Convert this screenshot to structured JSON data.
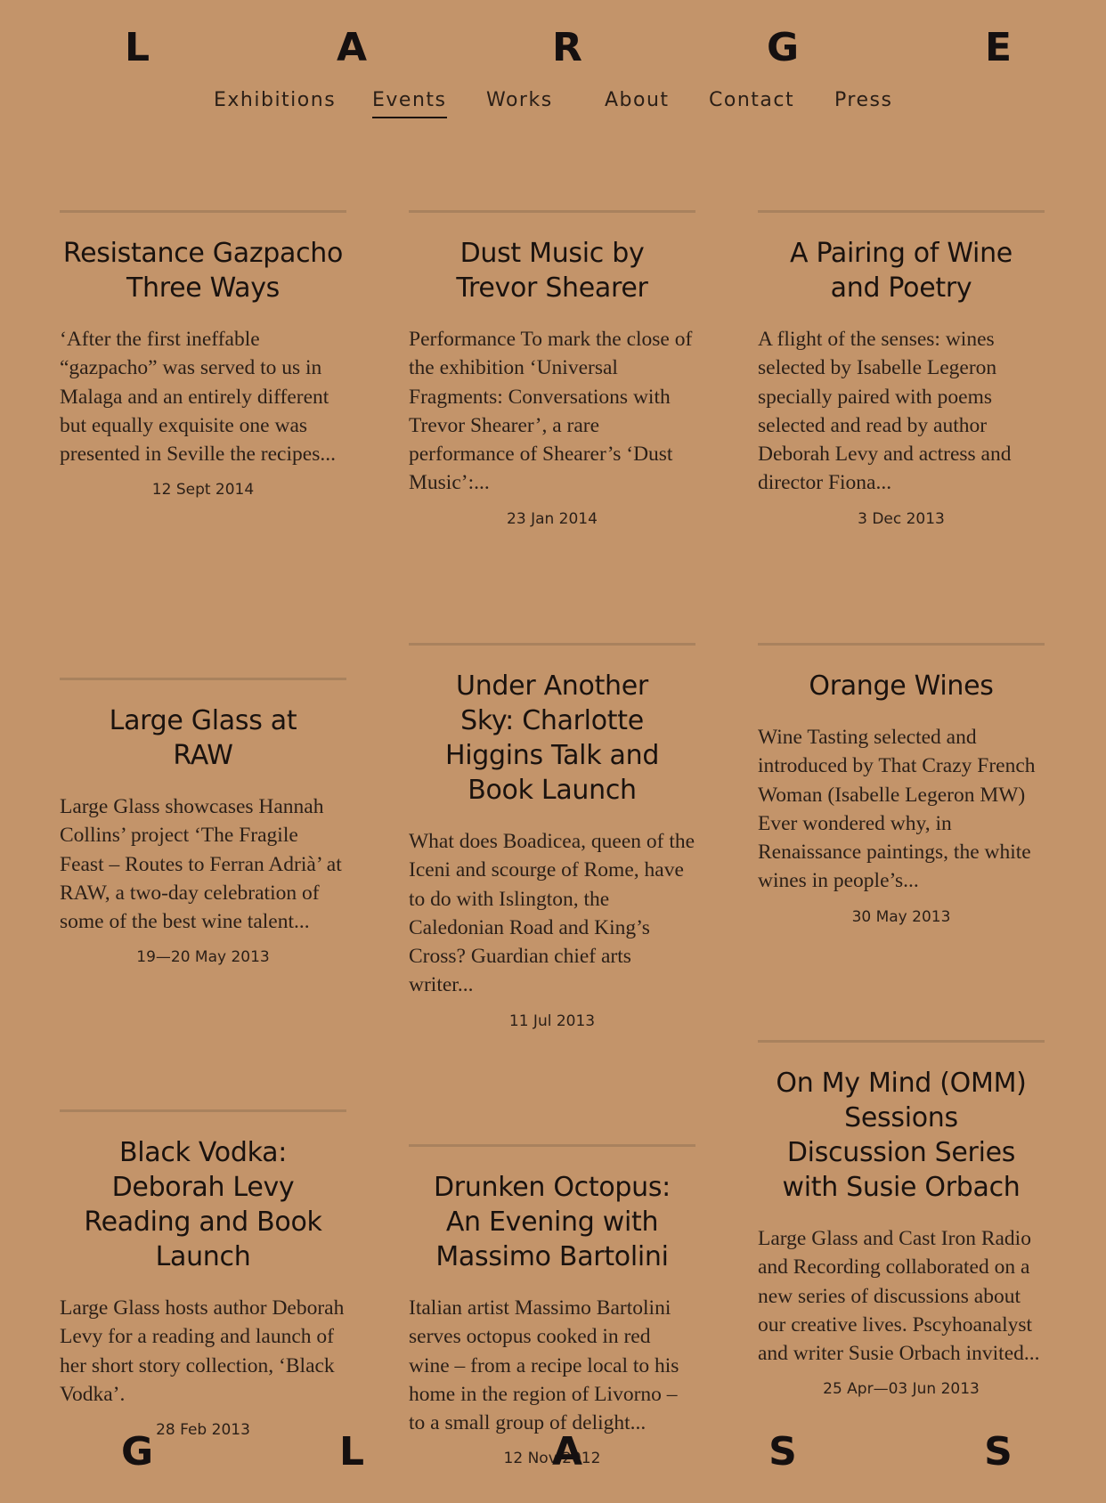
{
  "brand": {
    "top_letters": [
      "L",
      "A",
      "R",
      "G",
      "E"
    ],
    "bottom_letters": [
      "G",
      "L",
      "A",
      "S",
      "S"
    ]
  },
  "nav": {
    "items": [
      "Exhibitions",
      "Events",
      "Works",
      "About",
      "Contact",
      "Press"
    ],
    "active": "Events"
  },
  "events": [
    {
      "title": "Resistance Gazpacho Three Ways",
      "excerpt": "‘After the first ineffable “gazpacho” was served to us in Malaga and an entirely different but equally exquisite one was presented in Seville the recipes...",
      "date": "12 Sept 2014"
    },
    {
      "title": "Dust Music by Trevor Shearer",
      "excerpt": "Performance To mark the close of the exhibition ‘Universal Fragments: Conversations with Trevor Shearer’, a rare performance of Shearer’s ‘Dust Music’:...",
      "date": "23 Jan 2014"
    },
    {
      "title": "A Pairing of Wine and Poetry",
      "excerpt": "A flight of the senses: wines selected by Isabelle Legeron specially paired with poems selected and read by author Deborah Levy and actress and director Fiona...",
      "date": "3 Dec 2013"
    },
    {
      "title": "Large Glass at RAW",
      "excerpt": "Large Glass showcases Hannah Collins’ project ‘The Fragile Feast – Routes to Ferran Adrià’ at RAW, a two-day celebration of some of the best wine talent...",
      "date": "19—20 May 2013"
    },
    {
      "title": "Under Another Sky: Charlotte Higgins Talk and Book Launch",
      "excerpt": "What does Boadicea, queen of the Iceni and scourge of Rome, have to do with Islington, the Caledonian Road and King’s Cross? Guardian chief arts writer...",
      "date": "11 Jul 2013"
    },
    {
      "title": "Orange Wines",
      "excerpt": "Wine Tasting selected and introduced by That Crazy French Woman (Isabelle Legeron MW) Ever wondered why, in Renaissance paintings, the white wines in people’s...",
      "date": "30 May 2013"
    },
    {
      "title": "Black Vodka: Deborah Levy Reading and Book Launch",
      "excerpt": "Large Glass hosts author Deborah Levy for a reading and launch of her short story collection, ‘Black Vodka’.",
      "date": "28 Feb 2013"
    },
    {
      "title": "Drunken Octopus: An Evening with Massimo Bartolini",
      "excerpt": "Italian artist Massimo Bartolini serves octopus cooked in red wine – from a recipe local to his home in the region of Livorno – to a small group of delight...",
      "date": "12 Nov 2012"
    },
    {
      "title": "On My Mind (OMM) Sessions Discussion Series with Susie Orbach",
      "excerpt": "Large Glass and Cast Iron Radio and Recording collaborated on a new series of discussions about our creative lives. Pscyhoanalyst and writer Susie Orbach invited...",
      "date": "25 Apr—03 Jun 2013"
    }
  ]
}
